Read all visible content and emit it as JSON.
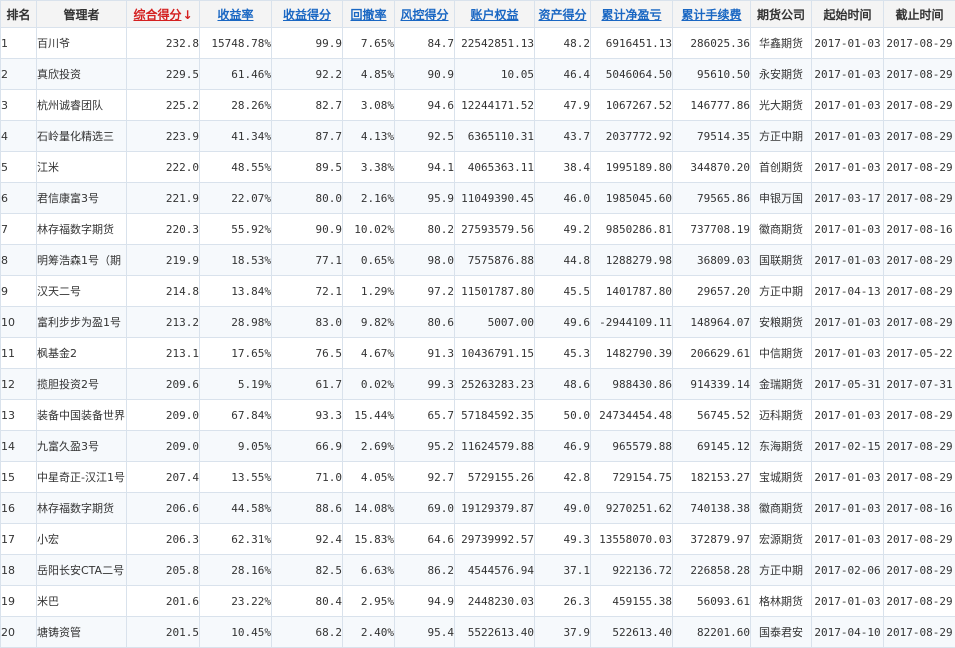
{
  "table": {
    "columns": [
      {
        "key": "rank",
        "label": "排名",
        "sortable": false,
        "sorted": false
      },
      {
        "key": "manager",
        "label": "管理者",
        "sortable": false,
        "sorted": false
      },
      {
        "key": "score",
        "label": "综合得分",
        "sortable": true,
        "sorted": true
      },
      {
        "key": "return_rate",
        "label": "收益率",
        "sortable": true,
        "sorted": false
      },
      {
        "key": "return_score",
        "label": "收益得分",
        "sortable": true,
        "sorted": false
      },
      {
        "key": "drawdown",
        "label": "回撤率",
        "sortable": true,
        "sorted": false
      },
      {
        "key": "risk_score",
        "label": "风控得分",
        "sortable": true,
        "sorted": false
      },
      {
        "key": "equity",
        "label": "账户权益",
        "sortable": true,
        "sorted": false
      },
      {
        "key": "asset_score",
        "label": "资产得分",
        "sortable": true,
        "sorted": false
      },
      {
        "key": "net_pnl",
        "label": "累计净盈亏",
        "sortable": true,
        "sorted": false
      },
      {
        "key": "fees",
        "label": "累计手续费",
        "sortable": true,
        "sorted": false
      },
      {
        "key": "company",
        "label": "期货公司",
        "sortable": false,
        "sorted": false
      },
      {
        "key": "start",
        "label": "起始时间",
        "sortable": false,
        "sorted": false
      },
      {
        "key": "end",
        "label": "截止时间",
        "sortable": false,
        "sorted": false
      }
    ],
    "sort_arrow": "↓",
    "rows": [
      {
        "rank": "1",
        "manager": "百川爷",
        "score": "232.8",
        "return_rate": "15748.78%",
        "return_score": "99.9",
        "drawdown": "7.65%",
        "risk_score": "84.7",
        "equity": "22542851.13",
        "asset_score": "48.2",
        "net_pnl": "6916451.13",
        "fees": "286025.36",
        "company": "华鑫期货",
        "start": "2017-01-03",
        "end": "2017-08-29"
      },
      {
        "rank": "2",
        "manager": "真欣投资",
        "score": "229.5",
        "return_rate": "61.46%",
        "return_score": "92.2",
        "drawdown": "4.85%",
        "risk_score": "90.9",
        "equity": "10.05",
        "asset_score": "46.4",
        "net_pnl": "5046064.50",
        "fees": "95610.50",
        "company": "永安期货",
        "start": "2017-01-03",
        "end": "2017-08-29"
      },
      {
        "rank": "3",
        "manager": "杭州诚睿团队",
        "score": "225.2",
        "return_rate": "28.26%",
        "return_score": "82.7",
        "drawdown": "3.08%",
        "risk_score": "94.6",
        "equity": "12244171.52",
        "asset_score": "47.9",
        "net_pnl": "1067267.52",
        "fees": "146777.86",
        "company": "光大期货",
        "start": "2017-01-03",
        "end": "2017-08-29"
      },
      {
        "rank": "4",
        "manager": "石岭量化精选三",
        "score": "223.9",
        "return_rate": "41.34%",
        "return_score": "87.7",
        "drawdown": "4.13%",
        "risk_score": "92.5",
        "equity": "6365110.31",
        "asset_score": "43.7",
        "net_pnl": "2037772.92",
        "fees": "79514.35",
        "company": "方正中期",
        "start": "2017-01-03",
        "end": "2017-08-29"
      },
      {
        "rank": "5",
        "manager": "江米",
        "score": "222.0",
        "return_rate": "48.55%",
        "return_score": "89.5",
        "drawdown": "3.38%",
        "risk_score": "94.1",
        "equity": "4065363.11",
        "asset_score": "38.4",
        "net_pnl": "1995189.80",
        "fees": "344870.20",
        "company": "首创期货",
        "start": "2017-01-03",
        "end": "2017-08-29"
      },
      {
        "rank": "6",
        "manager": "君信康富3号",
        "score": "221.9",
        "return_rate": "22.07%",
        "return_score": "80.0",
        "drawdown": "2.16%",
        "risk_score": "95.9",
        "equity": "11049390.45",
        "asset_score": "46.0",
        "net_pnl": "1985045.60",
        "fees": "79565.86",
        "company": "申银万国",
        "start": "2017-03-17",
        "end": "2017-08-29"
      },
      {
        "rank": "7",
        "manager": "林存福数字期货",
        "score": "220.3",
        "return_rate": "55.92%",
        "return_score": "90.9",
        "drawdown": "10.02%",
        "risk_score": "80.2",
        "equity": "27593579.56",
        "asset_score": "49.2",
        "net_pnl": "9850286.81",
        "fees": "737708.19",
        "company": "徽商期货",
        "start": "2017-01-03",
        "end": "2017-08-16"
      },
      {
        "rank": "8",
        "manager": "明筹浩森1号（期",
        "score": "219.9",
        "return_rate": "18.53%",
        "return_score": "77.1",
        "drawdown": "0.65%",
        "risk_score": "98.0",
        "equity": "7575876.88",
        "asset_score": "44.8",
        "net_pnl": "1288279.98",
        "fees": "36809.03",
        "company": "国联期货",
        "start": "2017-01-03",
        "end": "2017-08-29"
      },
      {
        "rank": "9",
        "manager": "汉天二号",
        "score": "214.8",
        "return_rate": "13.84%",
        "return_score": "72.1",
        "drawdown": "1.29%",
        "risk_score": "97.2",
        "equity": "11501787.80",
        "asset_score": "45.5",
        "net_pnl": "1401787.80",
        "fees": "29657.20",
        "company": "方正中期",
        "start": "2017-04-13",
        "end": "2017-08-29"
      },
      {
        "rank": "10",
        "manager": "富利步步为盈1号",
        "score": "213.2",
        "return_rate": "28.98%",
        "return_score": "83.0",
        "drawdown": "9.82%",
        "risk_score": "80.6",
        "equity": "5007.00",
        "asset_score": "49.6",
        "net_pnl": "-2944109.11",
        "fees": "148964.07",
        "company": "安粮期货",
        "start": "2017-01-03",
        "end": "2017-08-29"
      },
      {
        "rank": "11",
        "manager": "枫基金2",
        "score": "213.1",
        "return_rate": "17.65%",
        "return_score": "76.5",
        "drawdown": "4.67%",
        "risk_score": "91.3",
        "equity": "10436791.15",
        "asset_score": "45.3",
        "net_pnl": "1482790.39",
        "fees": "206629.61",
        "company": "中信期货",
        "start": "2017-01-03",
        "end": "2017-05-22"
      },
      {
        "rank": "12",
        "manager": "揽胆投资2号",
        "score": "209.6",
        "return_rate": "5.19%",
        "return_score": "61.7",
        "drawdown": "0.02%",
        "risk_score": "99.3",
        "equity": "25263283.23",
        "asset_score": "48.6",
        "net_pnl": "988430.86",
        "fees": "914339.14",
        "company": "金瑞期货",
        "start": "2017-05-31",
        "end": "2017-07-31"
      },
      {
        "rank": "13",
        "manager": "装备中国装备世界",
        "score": "209.0",
        "return_rate": "67.84%",
        "return_score": "93.3",
        "drawdown": "15.44%",
        "risk_score": "65.7",
        "equity": "57184592.35",
        "asset_score": "50.0",
        "net_pnl": "24734454.48",
        "fees": "56745.52",
        "company": "迈科期货",
        "start": "2017-01-03",
        "end": "2017-08-29"
      },
      {
        "rank": "14",
        "manager": "九富久盈3号",
        "score": "209.0",
        "return_rate": "9.05%",
        "return_score": "66.9",
        "drawdown": "2.69%",
        "risk_score": "95.2",
        "equity": "11624579.88",
        "asset_score": "46.9",
        "net_pnl": "965579.88",
        "fees": "69145.12",
        "company": "东海期货",
        "start": "2017-02-15",
        "end": "2017-08-29"
      },
      {
        "rank": "15",
        "manager": "中星奇正-汉江1号",
        "score": "207.4",
        "return_rate": "13.55%",
        "return_score": "71.0",
        "drawdown": "4.05%",
        "risk_score": "92.7",
        "equity": "5729155.26",
        "asset_score": "42.8",
        "net_pnl": "729154.75",
        "fees": "182153.27",
        "company": "宝城期货",
        "start": "2017-01-03",
        "end": "2017-08-29"
      },
      {
        "rank": "16",
        "manager": "林存福数字期货",
        "score": "206.6",
        "return_rate": "44.58%",
        "return_score": "88.6",
        "drawdown": "14.08%",
        "risk_score": "69.0",
        "equity": "19129379.87",
        "asset_score": "49.0",
        "net_pnl": "9270251.62",
        "fees": "740138.38",
        "company": "徽商期货",
        "start": "2017-01-03",
        "end": "2017-08-16"
      },
      {
        "rank": "17",
        "manager": "小宏",
        "score": "206.3",
        "return_rate": "62.31%",
        "return_score": "92.4",
        "drawdown": "15.83%",
        "risk_score": "64.6",
        "equity": "29739992.57",
        "asset_score": "49.3",
        "net_pnl": "13558070.03",
        "fees": "372879.97",
        "company": "宏源期货",
        "start": "2017-01-03",
        "end": "2017-08-29"
      },
      {
        "rank": "18",
        "manager": "岳阳长安CTA二号",
        "score": "205.8",
        "return_rate": "28.16%",
        "return_score": "82.5",
        "drawdown": "6.63%",
        "risk_score": "86.2",
        "equity": "4544576.94",
        "asset_score": "37.1",
        "net_pnl": "922136.72",
        "fees": "226858.28",
        "company": "方正中期",
        "start": "2017-02-06",
        "end": "2017-08-29"
      },
      {
        "rank": "19",
        "manager": "米巴",
        "score": "201.6",
        "return_rate": "23.22%",
        "return_score": "80.4",
        "drawdown": "2.95%",
        "risk_score": "94.9",
        "equity": "2448230.03",
        "asset_score": "26.3",
        "net_pnl": "459155.38",
        "fees": "56093.61",
        "company": "格林期货",
        "start": "2017-01-03",
        "end": "2017-08-29"
      },
      {
        "rank": "20",
        "manager": "塘铸资管",
        "score": "201.5",
        "return_rate": "10.45%",
        "return_score": "68.2",
        "drawdown": "2.40%",
        "risk_score": "95.4",
        "equity": "5522613.40",
        "asset_score": "37.9",
        "net_pnl": "522613.40",
        "fees": "82201.60",
        "company": "国泰君安",
        "start": "2017-04-10",
        "end": "2017-08-29"
      }
    ]
  },
  "colors": {
    "positive": "#d42020",
    "negative": "#4a9a18",
    "link": "#1a67c3"
  }
}
